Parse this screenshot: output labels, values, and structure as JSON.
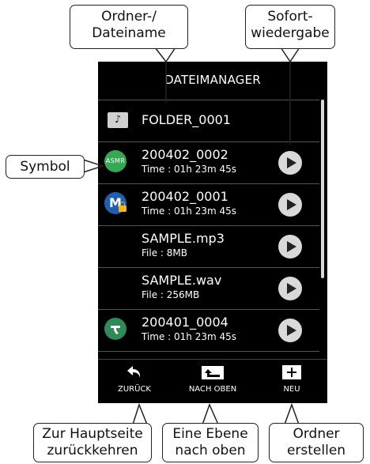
{
  "screen": {
    "title": "DATEIMANAGER",
    "rows": [
      {
        "name": "FOLDER_0001",
        "sub": "",
        "icon": "folder-note-icon",
        "icon_glyph": "♪",
        "play": false
      },
      {
        "name": "200402_0002",
        "sub": "Time : 01h 23m 45s",
        "icon": "asmr-symbol",
        "icon_text": "ASMR",
        "icon_color": "#34a853",
        "play": true
      },
      {
        "name": "200402_0001",
        "sub": "Time : 01h 23m 45s",
        "icon": "m-lock-symbol",
        "icon_text": "M",
        "icon_color": "#1f5fb2",
        "play": true
      },
      {
        "name": "SAMPLE.mp3",
        "sub": "File : 8MB",
        "icon": "",
        "play": true
      },
      {
        "name": "SAMPLE.wav",
        "sub": "File : 256MB",
        "icon": "",
        "play": true
      },
      {
        "name": "200401_0004",
        "sub": "Time : 01h 23m 45s",
        "icon": "green-symbol",
        "icon_color": "#2e8b57",
        "play": true
      }
    ],
    "toolbar": {
      "back_label": "ZURÜCK",
      "up_label": "NACH OBEN",
      "new_label": "NEU"
    }
  },
  "callouts": {
    "folder_file_name": {
      "line1": "Ordner-/",
      "line2": "Dateiname"
    },
    "instant_play": {
      "line1": "Sofort-",
      "line2": "wiedergabe"
    },
    "symbol": "Symbol",
    "back_home": {
      "line1": "Zur Hauptseite",
      "line2": "zurückkehren"
    },
    "level_up": {
      "line1": "Eine Ebene",
      "line2": "nach oben"
    },
    "create_folder": {
      "line1": "Ordner",
      "line2": "erstellen"
    }
  }
}
